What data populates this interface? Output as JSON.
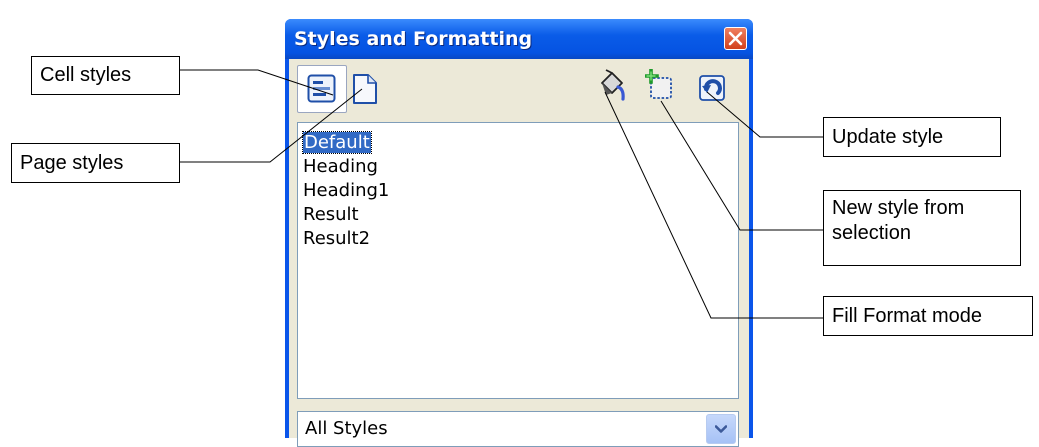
{
  "window": {
    "title": "Styles and Formatting"
  },
  "toolbar": {
    "cell_styles_icon": "cell-styles-icon",
    "page_styles_icon": "page-styles-icon",
    "fill_format_icon": "paint-bucket-icon",
    "new_style_icon": "new-style-icon",
    "update_style_icon": "update-style-icon"
  },
  "styles_list": {
    "items": [
      {
        "label": "Default",
        "selected": true
      },
      {
        "label": "Heading",
        "selected": false
      },
      {
        "label": "Heading1",
        "selected": false
      },
      {
        "label": "Result",
        "selected": false
      },
      {
        "label": "Result2",
        "selected": false
      }
    ]
  },
  "filter": {
    "value": "All Styles"
  },
  "callouts": {
    "cell_styles": "Cell styles",
    "page_styles": "Page styles",
    "update_style": "Update style",
    "new_style_line1": "New style from",
    "new_style_line2": "selection",
    "fill_format": "Fill Format mode"
  },
  "colors": {
    "titlebar": "#0a55ea",
    "client": "#ece9d8",
    "selection": "#316ac5",
    "close": "#d2401c"
  }
}
